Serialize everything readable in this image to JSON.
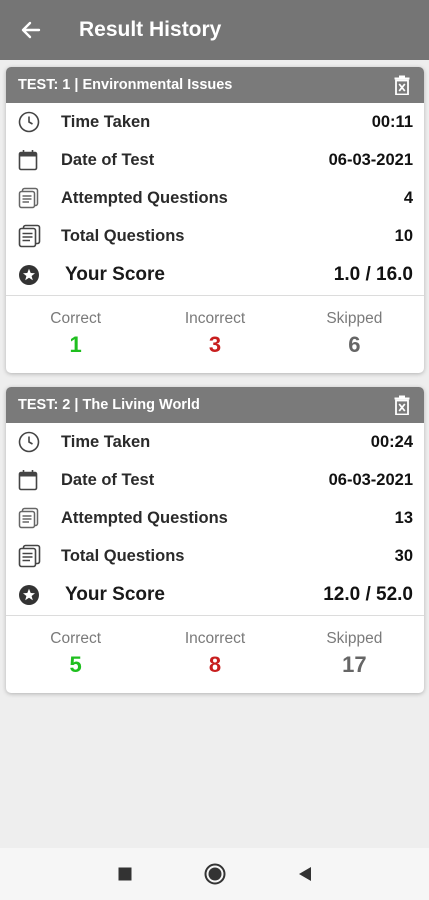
{
  "app_bar": {
    "title": "Result History",
    "back_icon": "arrow-left-icon"
  },
  "colors": {
    "app_bar_bg": "#757575",
    "card_header_bg": "#7a7a7a",
    "correct": "#1fbf1f",
    "incorrect": "#c81e1e",
    "skipped": "#666666"
  },
  "labels": {
    "time_taken": "Time Taken",
    "date_of_test": "Date of Test",
    "attempted_questions": "Attempted Questions",
    "total_questions": "Total Questions",
    "your_score": "Your Score",
    "correct": "Correct",
    "incorrect": "Incorrect",
    "skipped": "Skipped"
  },
  "results": [
    {
      "title": "TEST: 1 | Environmental Issues",
      "time_taken": "00:11",
      "date_of_test": "06-03-2021",
      "attempted_questions": "4",
      "total_questions": "10",
      "your_score": "1.0 / 16.0",
      "correct": "1",
      "incorrect": "3",
      "skipped": "6"
    },
    {
      "title": "TEST: 2 | The Living World",
      "time_taken": "00:24",
      "date_of_test": "06-03-2021",
      "attempted_questions": "13",
      "total_questions": "30",
      "your_score": "12.0 / 52.0",
      "correct": "5",
      "incorrect": "8",
      "skipped": "17"
    }
  ],
  "nav_bar": {
    "icons": [
      "recents-square-icon",
      "home-circle-icon",
      "back-triangle-icon"
    ]
  }
}
